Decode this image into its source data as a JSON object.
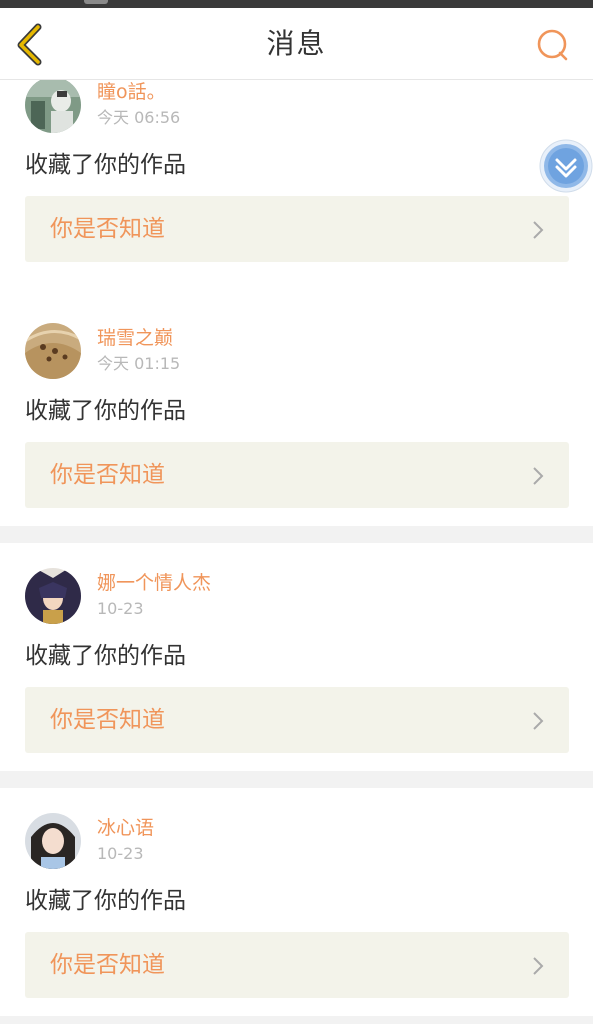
{
  "header": {
    "title": "消息",
    "back_icon": "chevron-left-icon",
    "search_icon": "search-icon",
    "accent_color": "#f0955a",
    "back_color": "#e0b200"
  },
  "messages": [
    {
      "username": "瞳o話。",
      "time": "今天 06:56",
      "action": "收藏了你的作品",
      "link": "你是否知道"
    },
    {
      "username": "瑞雪之巅",
      "time": "今天 01:15",
      "action": "收藏了你的作品",
      "link": "你是否知道"
    },
    {
      "username": "娜一个情人杰",
      "time": "10-23",
      "action": "收藏了你的作品",
      "link": "你是否知道"
    },
    {
      "username": "冰心语",
      "time": "10-23",
      "action": "收藏了你的作品",
      "link": "你是否知道"
    }
  ],
  "colors": {
    "username": "#f0955a",
    "link_text": "#f0955a",
    "link_bg": "#f3f3ea",
    "time": "#b8b8b8",
    "separator": "#f2f2f2"
  },
  "floating_button_icon": "double-chevron-down-icon"
}
